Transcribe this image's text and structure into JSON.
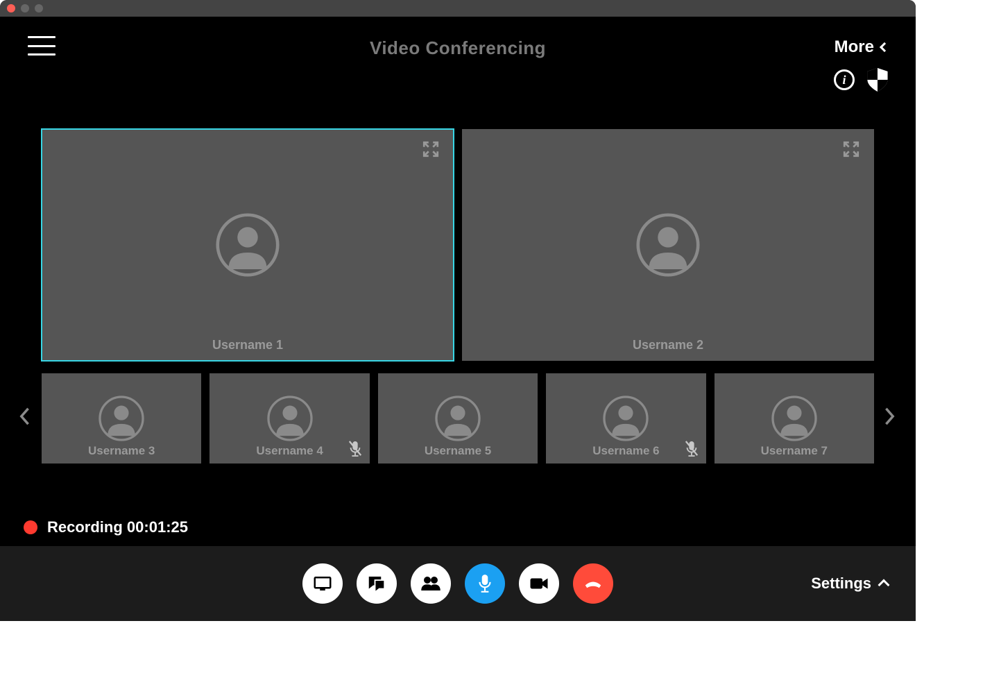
{
  "header": {
    "title": "Video Conferencing",
    "more_label": "More"
  },
  "participants_large": [
    {
      "name": "Username 1",
      "active": true
    },
    {
      "name": "Username 2",
      "active": false
    }
  ],
  "participants_small": [
    {
      "name": "Username 3",
      "muted": false
    },
    {
      "name": "Username 4",
      "muted": true
    },
    {
      "name": "Username 5",
      "muted": false
    },
    {
      "name": "Username 6",
      "muted": true
    },
    {
      "name": "Username 7",
      "muted": false
    }
  ],
  "recording": {
    "label": "Recording",
    "time": "00:01:25"
  },
  "bottom": {
    "settings_label": "Settings"
  },
  "icons": {
    "hamburger": "menu-icon",
    "chevron_left": "chevron-left-icon",
    "info": "info-icon",
    "shield": "shield-icon",
    "expand": "expand-icon",
    "avatar": "avatar-icon",
    "mic_muted": "mic-muted-icon",
    "nav_left": "nav-previous-icon",
    "nav_right": "nav-next-icon",
    "share": "share-screen-icon",
    "chat": "chat-icon",
    "people": "participants-icon",
    "mic": "microphone-icon",
    "camera": "camera-icon",
    "hangup": "hangup-icon",
    "chevron_up": "chevron-up-icon"
  },
  "colors": {
    "accent_active_border": "#38d6e5",
    "record_red": "#ff3a2f",
    "button_blue": "#1ba0f2",
    "button_red": "#ff4b3a",
    "tile_bg": "#555555"
  }
}
